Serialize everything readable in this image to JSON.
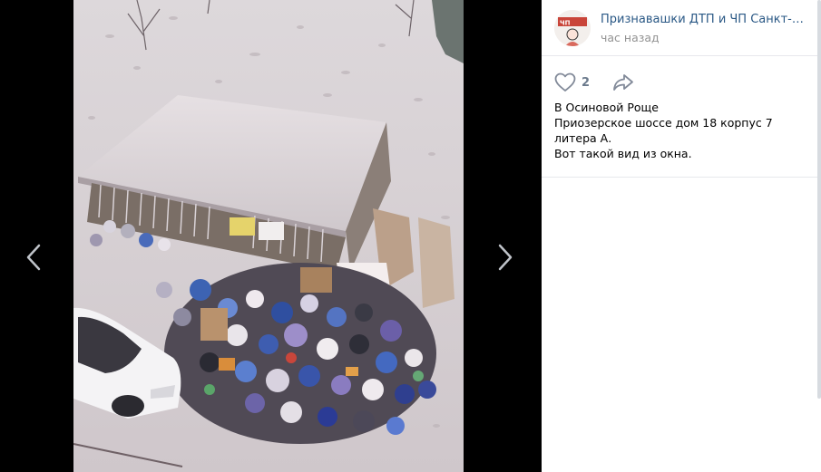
{
  "post": {
    "author": "Признавашки ДТП и ЧП Санкт-Петербург",
    "time": "час назад",
    "likes": "2",
    "text_lines": [
      "В Осиновой Роще",
      "Приозерское шоссе дом 18 корпус 7 литера А.",
      "Вот такой вид из окна."
    ]
  },
  "avatar": {
    "badge_text": "ЧП"
  },
  "icons": {
    "prev": "chevron-left-icon",
    "next": "chevron-right-icon",
    "like": "heart-icon",
    "share": "share-arrow-icon"
  },
  "colors": {
    "link": "#2a5885",
    "muted": "#939393",
    "icon": "#828a99"
  }
}
